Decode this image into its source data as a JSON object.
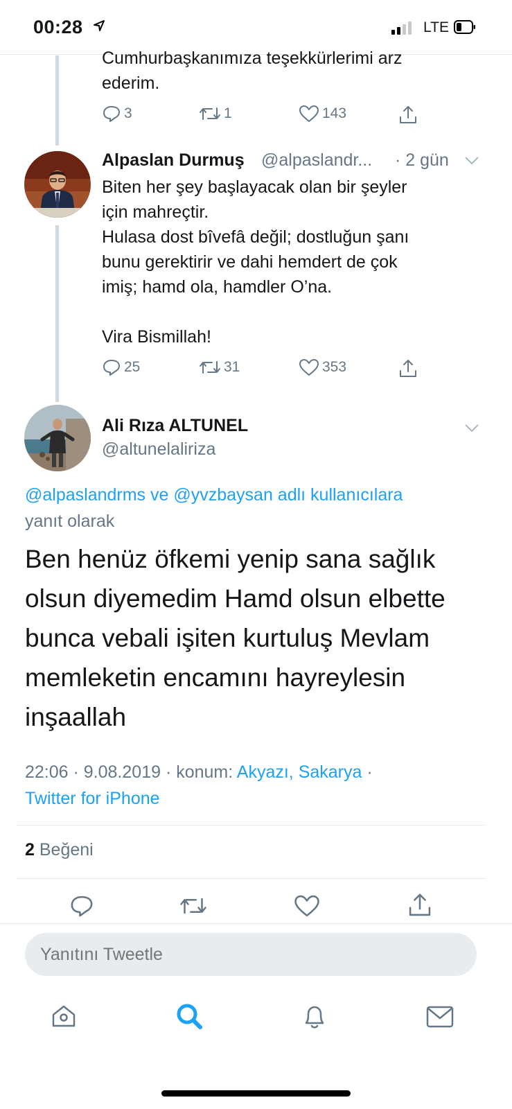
{
  "status_bar": {
    "time": "00:28",
    "network": "LTE"
  },
  "prev_tweet": {
    "text_tail": "Cumhurbaşkanımıza teşekkürlerimi arz\nederim.",
    "replies": "3",
    "retweets": "1",
    "likes": "143"
  },
  "tweet2": {
    "author_name": "Alpaslan Durmuş",
    "author_handle": "@alpaslandr...",
    "time_ago": "· 2 gün",
    "text": "Biten her şey başlayacak olan bir şeyler\niçin mahreçtir.\nHulasa dost bîvefâ değil; dostluğun şanı\nbunu gerektirir ve dahi hemdert de çok\nimiş; hamd ola, hamdler O’na.\n\nVira Bismillah!",
    "replies": "25",
    "retweets": "31",
    "likes": "353"
  },
  "main_tweet": {
    "author_name": "Ali Rıza ALTUNEL",
    "author_handle": "@altunelaliriza",
    "reply_mentions": "@alpaslandrms ve @yvzbaysan adlı kullanıcılara",
    "reply_suffix": "yanıt olarak",
    "text": "Ben henüz öfkemi yenip sana sağlık olsun diyemedim Hamd olsun elbette bunca vebali işiten kurtuluş Mevlam memleketin encamını hayreylesin inşaallah",
    "time": "22:06 · 9.08.2019 · konum:",
    "location": "Akyazı, Sakarya",
    "location_sep": " ·",
    "source": "Twitter for iPhone",
    "like_count": "2",
    "like_label": "Beğeni"
  },
  "reply_bar": {
    "placeholder": "Yanıtını Tweetle"
  },
  "tabbar": {
    "items": [
      "home-icon",
      "search-icon",
      "notifications-icon",
      "messages-icon"
    ],
    "active": "search-icon"
  },
  "colors": {
    "accent": "#1da1f2",
    "secondary_text": "#657786",
    "divider": "#e1e8ed"
  }
}
